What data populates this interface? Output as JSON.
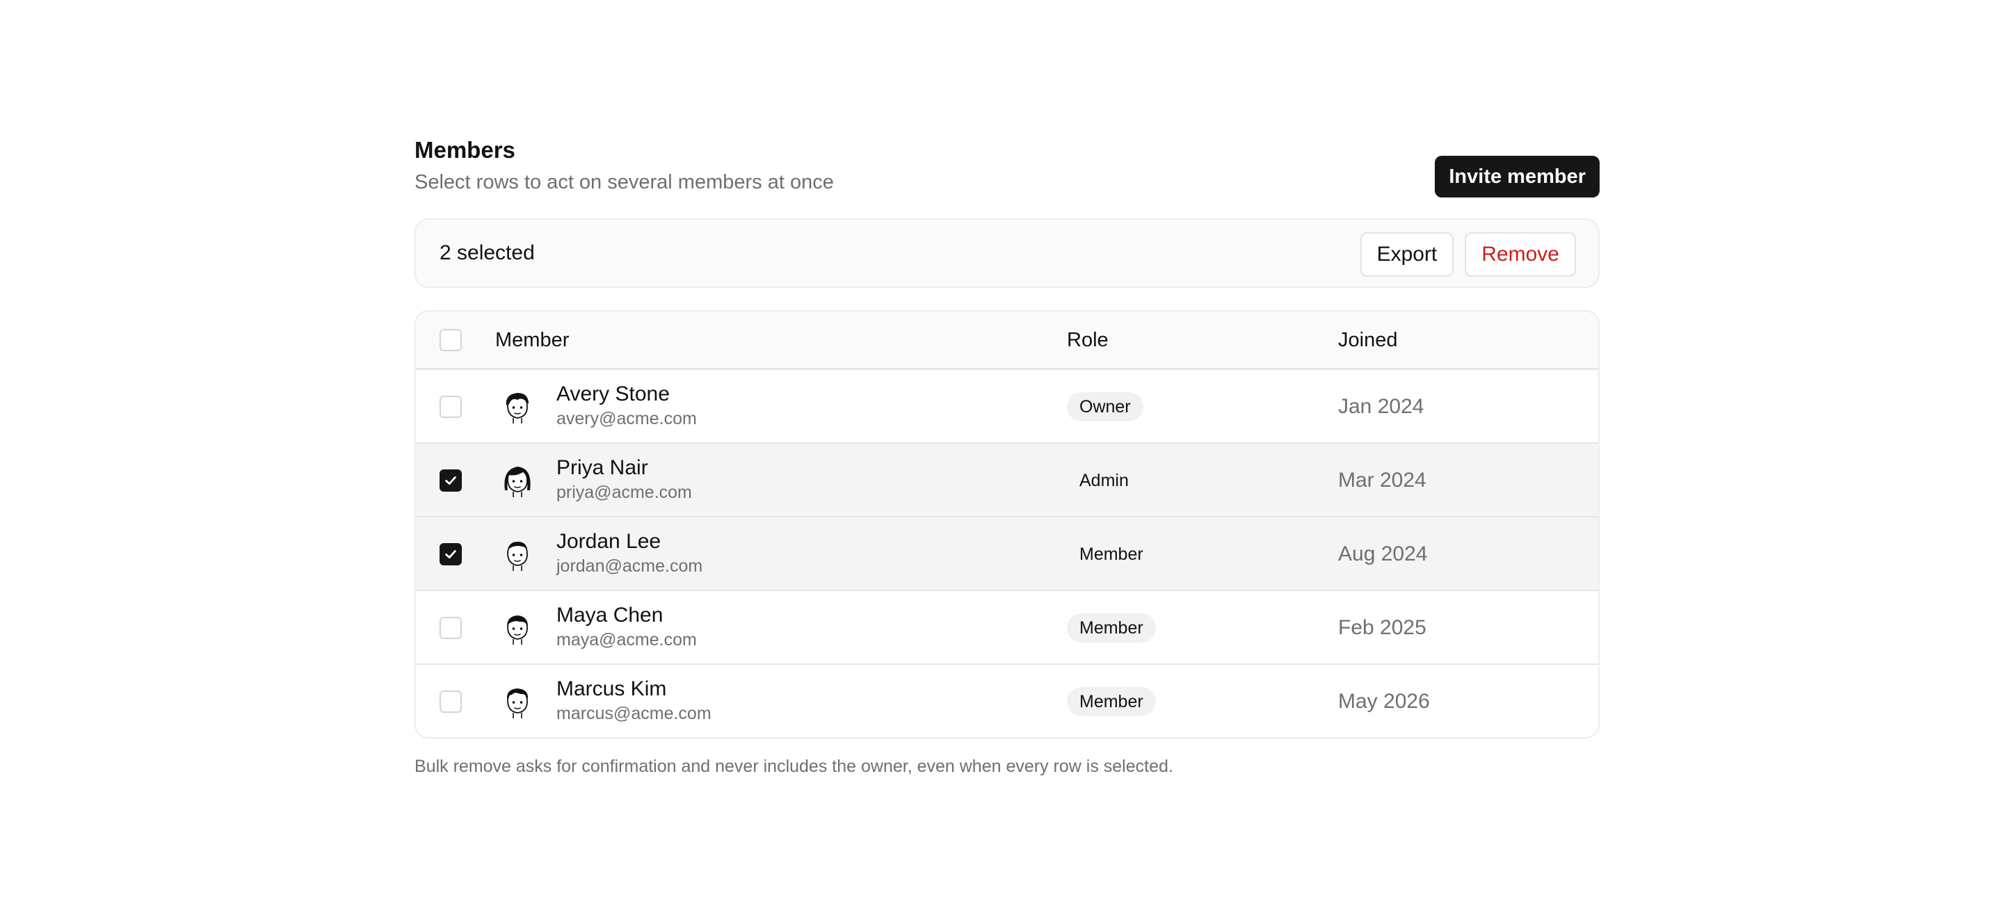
{
  "header": {
    "title": "Members",
    "subtitle": "Select rows to act on several members at once",
    "invite_label": "Invite member"
  },
  "bulk_bar": {
    "count_label": "2 selected",
    "export_label": "Export",
    "remove_label": "Remove",
    "remove_color": "#cc1f1f"
  },
  "table": {
    "columns": [
      "Member",
      "Role",
      "Joined"
    ],
    "select_all_checked": false,
    "rows": [
      {
        "name": "Avery Stone",
        "email": "avery@acme.com",
        "role": "Owner",
        "joined": "Jan 2024",
        "selected": false,
        "avatar": "avatar-illustration-icon"
      },
      {
        "name": "Priya Nair",
        "email": "priya@acme.com",
        "role": "Admin",
        "joined": "Mar 2024",
        "selected": true,
        "avatar": "avatar-illustration-icon"
      },
      {
        "name": "Jordan Lee",
        "email": "jordan@acme.com",
        "role": "Member",
        "joined": "Aug 2024",
        "selected": true,
        "avatar": "avatar-illustration-icon"
      },
      {
        "name": "Maya Chen",
        "email": "maya@acme.com",
        "role": "Member",
        "joined": "Feb 2025",
        "selected": false,
        "avatar": "avatar-illustration-icon"
      },
      {
        "name": "Marcus Kim",
        "email": "marcus@acme.com",
        "role": "Member",
        "joined": "May 2026",
        "selected": false,
        "avatar": "avatar-illustration-icon"
      }
    ]
  },
  "footnote": "Bulk remove asks for confirmation and never includes the owner, even when every row is selected.",
  "colors": {
    "primary_button": "#161616",
    "selected_row": "#f4f4f4",
    "muted_text": "#6f6f6f"
  }
}
